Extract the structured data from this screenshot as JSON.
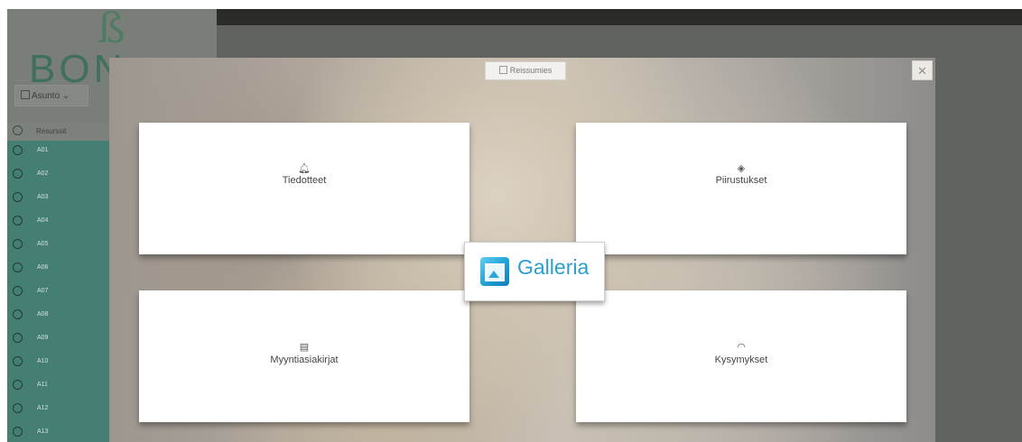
{
  "app": {
    "brand": "BON",
    "property_select": "Asunto",
    "property_caret": "⌄",
    "resources_header": "Resurssit"
  },
  "units": [
    "A01",
    "A02",
    "A03",
    "A04",
    "A05",
    "A06",
    "A07",
    "A08",
    "A09",
    "A10",
    "A11",
    "A12",
    "A13"
  ],
  "modal": {
    "tab_label": "Reissumies",
    "close_symbol": "×",
    "tiles": [
      {
        "icon": "🔔︎",
        "icon_name": "bell-icon",
        "label": "Tiedotteet"
      },
      {
        "icon": "◈",
        "icon_name": "layers-icon",
        "label": "Piirustukset"
      },
      {
        "icon": "▤",
        "icon_name": "document-icon",
        "label": "Myyntiasiakirjat"
      },
      {
        "icon": "◠",
        "icon_name": "question-icon",
        "label": "Kysymykset"
      }
    ],
    "galleria_label": "Galleria"
  },
  "colors": {
    "sidebar_accent": "#457e72",
    "galleria_blue": "#2a9fd0"
  }
}
